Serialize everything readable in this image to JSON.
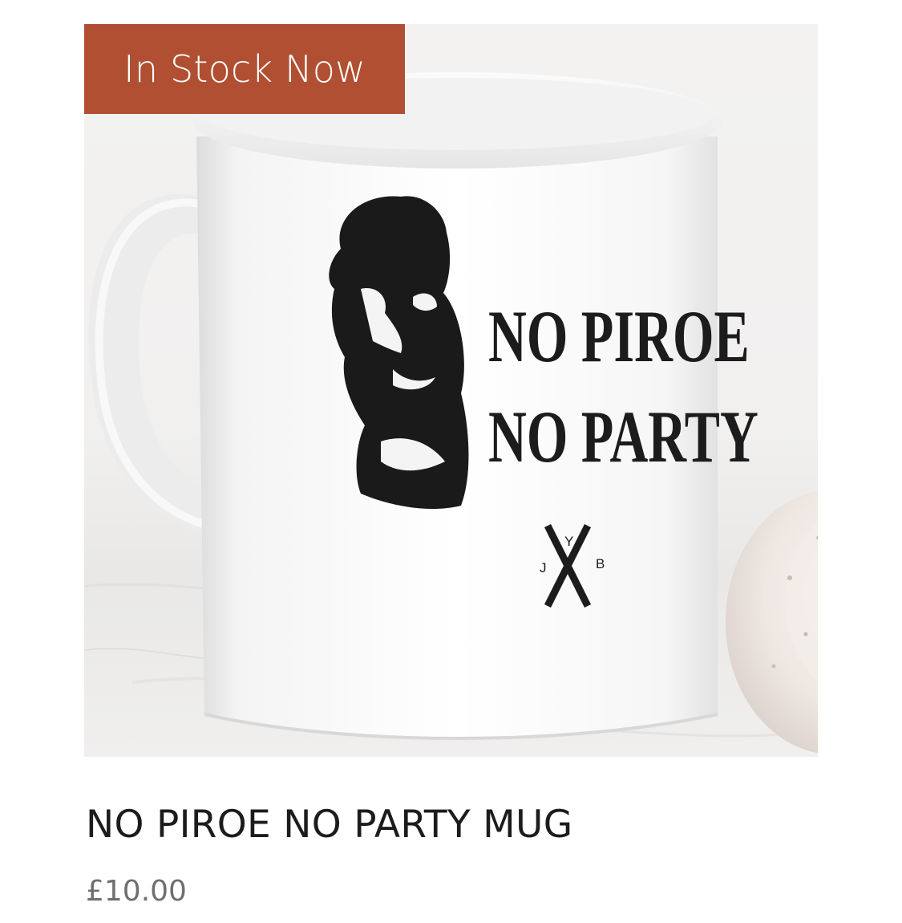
{
  "badge": {
    "label": "In Stock Now",
    "color": "#b04f32"
  },
  "product": {
    "title": "NO PIROE NO PARTY MUG",
    "price": "£10.00",
    "image": {
      "subject": "white mug",
      "print_line_1": "NO PIROE",
      "print_line_2": "NO PARTY",
      "logo_letters": [
        "Y",
        "J",
        "X",
        "B"
      ]
    }
  },
  "colors": {
    "title_text": "#1c1c1c",
    "price_text": "#6f6f6f"
  }
}
